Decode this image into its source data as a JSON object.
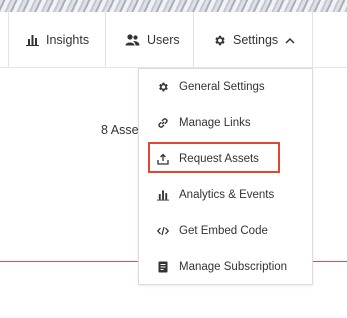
{
  "nav": {
    "insights_label": "Insights",
    "users_label": "Users",
    "settings_label": "Settings"
  },
  "main": {
    "assets_text": "8 Asse"
  },
  "settings_menu": {
    "items": [
      {
        "label": "General Settings",
        "icon": "gear-icon"
      },
      {
        "label": "Manage Links",
        "icon": "link-icon"
      },
      {
        "label": "Request Assets",
        "icon": "upload-icon"
      },
      {
        "label": "Analytics & Events",
        "icon": "bar-chart-icon"
      },
      {
        "label": "Get Embed Code",
        "icon": "code-icon"
      },
      {
        "label": "Manage Subscription",
        "icon": "document-icon"
      }
    ],
    "highlighted_item": "Request Assets"
  },
  "colors": {
    "highlight_border": "#e0472f",
    "divider_line": "#d9534f",
    "text": "#333333"
  }
}
